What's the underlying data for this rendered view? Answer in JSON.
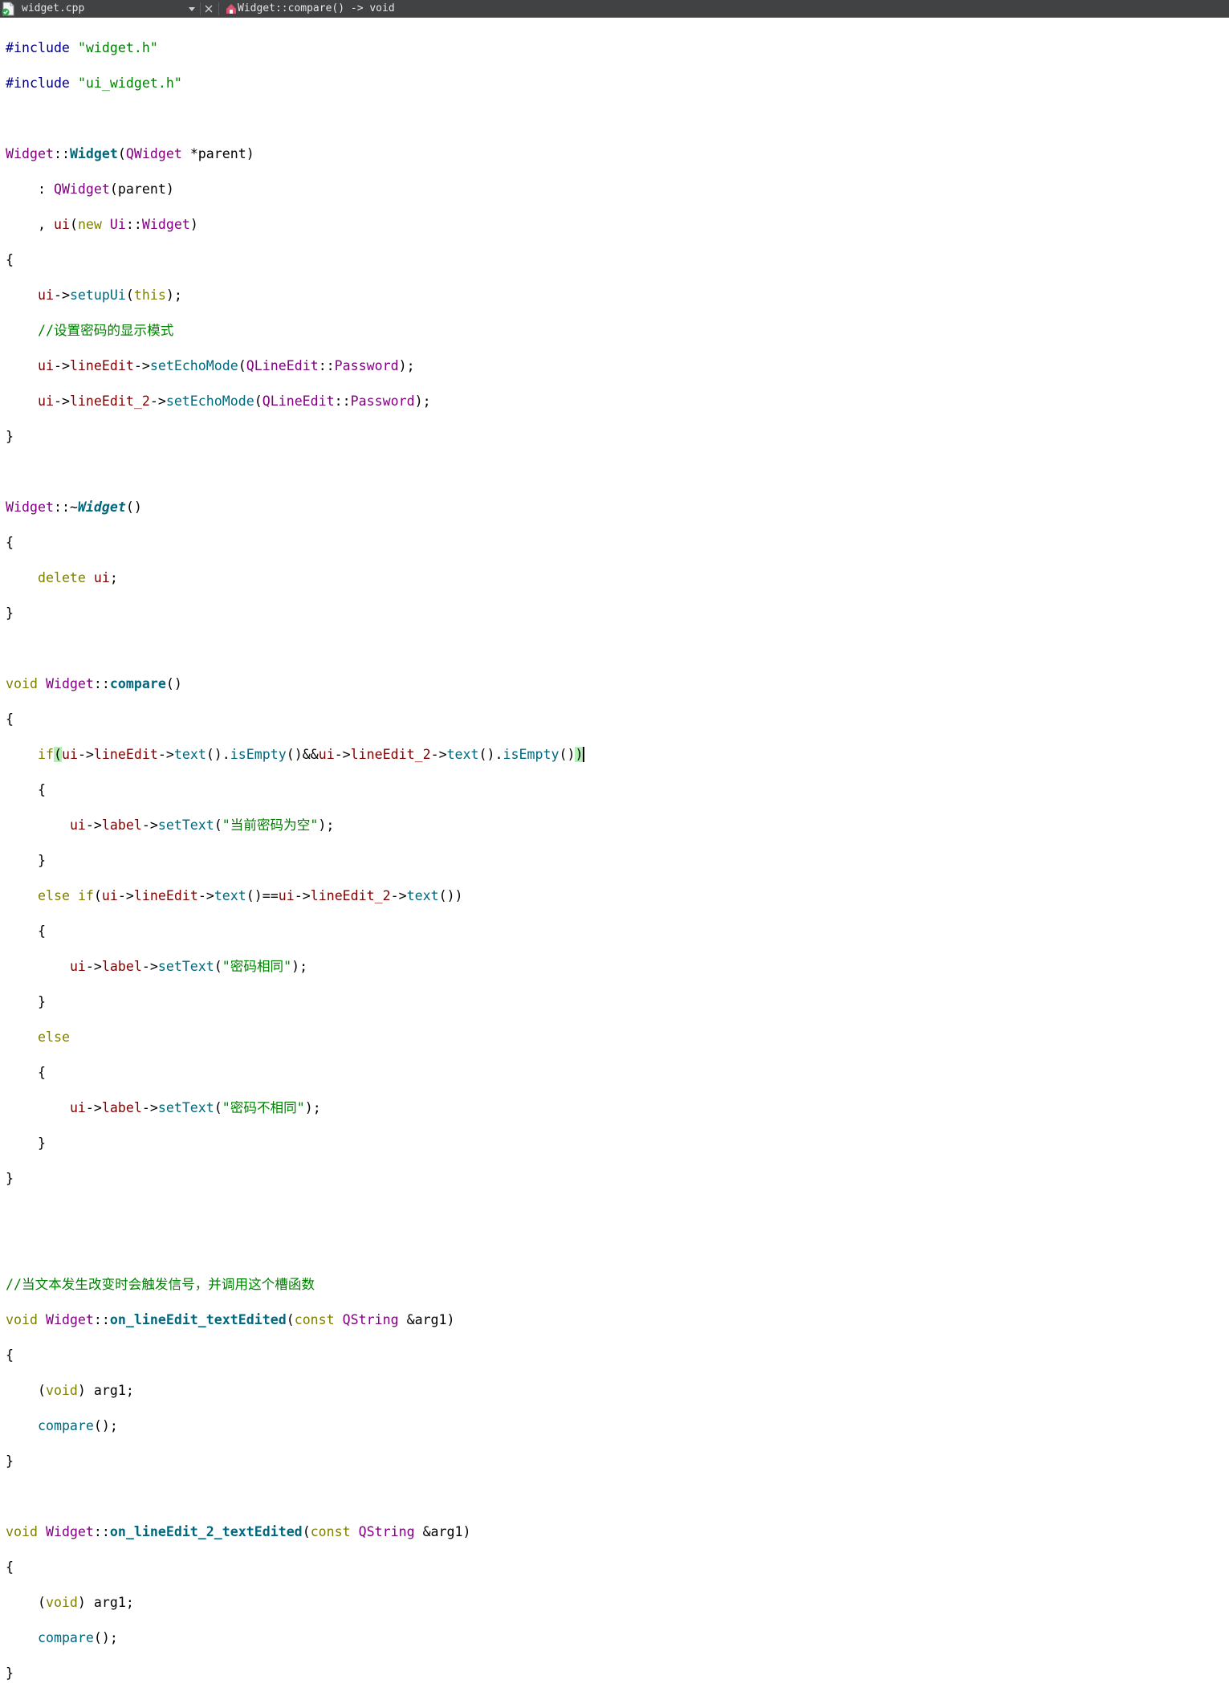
{
  "tabbar": {
    "file_name": "widget.cpp",
    "symbol": "Widget::compare() -> void"
  },
  "code": {
    "include1_kw": "#include",
    "include1_file": "\"widget.h\"",
    "include2_kw": "#include",
    "include2_file": "\"ui_widget.h\"",
    "comment_password_mode": "//设置密码的显示模式",
    "str_empty": "\"当前密码为空\"",
    "str_same": "\"密码相同\"",
    "str_diff": "\"密码不相同\"",
    "comment_slot": "//当文本发生改变时会触发信号，并调用这个槽函数",
    "slot1_name": "on_lineEdit_textEdited",
    "slot2_name": "on_lineEdit_2_textEdited"
  }
}
